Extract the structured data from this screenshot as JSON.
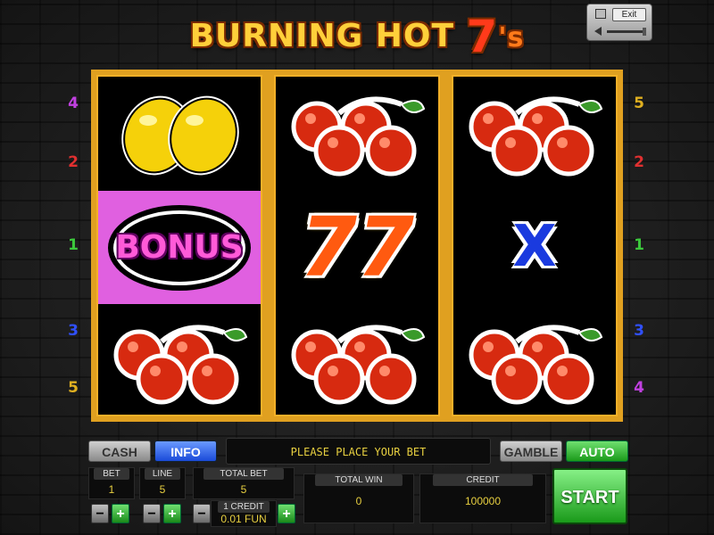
{
  "title": {
    "main": "BURNING HOT ",
    "seven": "7",
    "suffix": "'s"
  },
  "top_controls": {
    "exit_label": "Exit",
    "volume_icon": "speaker-icon",
    "fullscreen_icon": "screen-icon"
  },
  "paylines": {
    "left": [
      "4",
      "2",
      "1",
      "3",
      "5"
    ],
    "right": [
      "5",
      "2",
      "1",
      "3",
      "4"
    ]
  },
  "reels": [
    [
      "lemons",
      "bonus",
      "cherries"
    ],
    [
      "cherries",
      "sevens",
      "cherries"
    ],
    [
      "cherries",
      "wild-x",
      "cherries"
    ]
  ],
  "symbol_text": {
    "bonus": "BONUS",
    "sevens": "77",
    "wild": "X"
  },
  "buttons": {
    "cash": "CASH",
    "info": "INFO",
    "gamble": "GAMBLE",
    "auto": "AUTO",
    "start": "START",
    "minus": "−",
    "plus": "+"
  },
  "status_message": "PLEASE PLACE YOUR BET",
  "fields": {
    "bet": {
      "label": "BET",
      "value": "1"
    },
    "line": {
      "label": "LINE",
      "value": "5"
    },
    "total_bet": {
      "label": "TOTAL BET",
      "value": "5"
    },
    "credit_unit": {
      "label": "1 CREDIT",
      "value": "0.01 FUN"
    },
    "total_win": {
      "label": "TOTAL WIN",
      "value": "0"
    },
    "credit": {
      "label": "CREDIT",
      "value": "100000"
    }
  },
  "colors": {
    "frame": "#e0a020",
    "bonus_bg": "#e060e0",
    "info_btn": "#2a5ae8",
    "auto_btn": "#2aaa2a",
    "status_text": "#e8d040"
  }
}
